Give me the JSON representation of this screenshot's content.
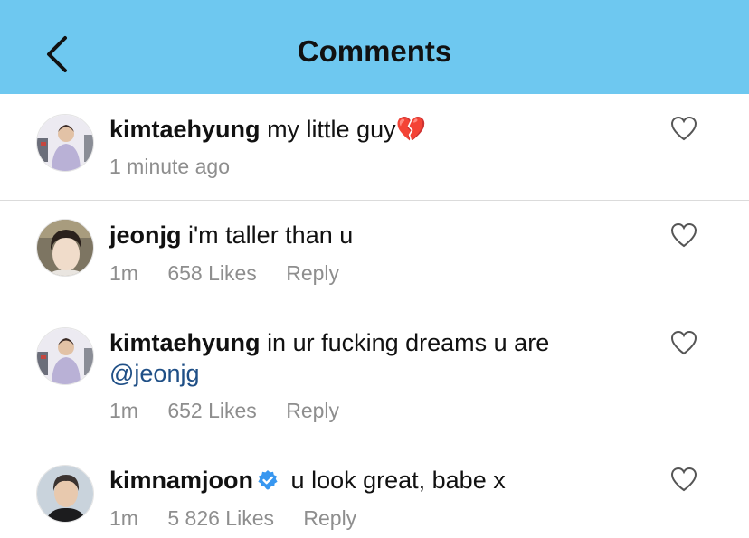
{
  "header": {
    "title": "Comments",
    "background": "#6ec8f0"
  },
  "caption": {
    "username": "kimtaehyung",
    "text": "my little guy💔",
    "time": "1 minute ago"
  },
  "comments": [
    {
      "username": "jeonjg",
      "text": "i'm taller than u",
      "time": "1m",
      "likes": "658 Likes",
      "reply_label": "Reply"
    },
    {
      "username": "kimtaehyung",
      "text": "in ur fucking dreams u are",
      "mention": "@jeonjg",
      "time": "1m",
      "likes": "652 Likes",
      "reply_label": "Reply"
    },
    {
      "username": "kimnamjoon",
      "verified": true,
      "text": "u look great, babe x",
      "time": "1m",
      "likes": "5 826 Likes",
      "reply_label": "Reply"
    }
  ],
  "icons": {
    "back": "chevron-left-icon",
    "like": "heart-outline-icon",
    "verified": "verified-badge-icon"
  },
  "colors": {
    "mention": "#1f4f86",
    "meta": "#8e8e8e",
    "verified": "#3897f0"
  }
}
